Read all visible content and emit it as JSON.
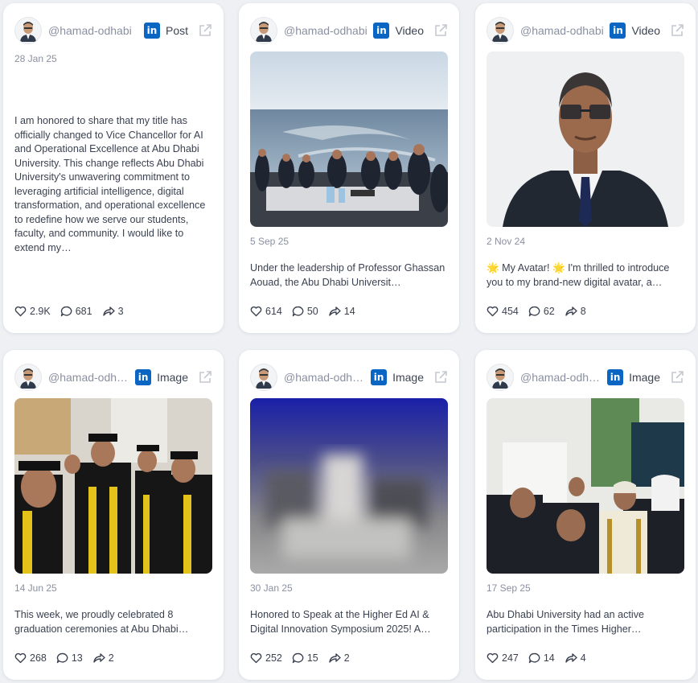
{
  "cards": [
    {
      "handle": "@hamad-odhabi",
      "type": "Post",
      "date": "28 Jan 25",
      "text": "I am honored to share that my title has officially changed to Vice Chancellor for AI and Operational Excellence at Abu Dhabi University. This change reflects Abu Dhabi University's unwavering commitment to leveraging artificial intelligence, digital transformation, and operational excellence to redefine how we serve our students, faculty, and community. I would like to extend my…",
      "likes": "2.9K",
      "comments": "681",
      "shares": "3"
    },
    {
      "handle": "@hamad-odhabi",
      "type": "Video",
      "date": "5 Sep 25",
      "text": "Under the leadership of Professor Ghassan Aouad, the Abu Dhabi Universit…",
      "likes": "614",
      "comments": "50",
      "shares": "14"
    },
    {
      "handle": "@hamad-odhabi",
      "type": "Video",
      "date": "2 Nov 24",
      "text": "🌟 My Avatar! 🌟 I'm thrilled to introduce you to my brand-new digital avatar, a…",
      "likes": "454",
      "comments": "62",
      "shares": "8"
    },
    {
      "handle": "@hamad-odhabi",
      "type": "Image",
      "date": "14 Jun 25",
      "text": "This week, we proudly celebrated 8 graduation ceremonies at Abu Dhabi…",
      "likes": "268",
      "comments": "13",
      "shares": "2"
    },
    {
      "handle": "@hamad-odhabi",
      "type": "Image",
      "date": "30 Jan 25",
      "text": "Honored to Speak at the Higher Ed AI & Digital Innovation Symposium 2025! A…",
      "likes": "252",
      "comments": "15",
      "shares": "2"
    },
    {
      "handle": "@hamad-odhabi",
      "type": "Image",
      "date": "17 Sep 25",
      "text": "Abu Dhabi University had an active participation in the Times Higher…",
      "likes": "247",
      "comments": "14",
      "shares": "4"
    }
  ],
  "colors": {
    "linkedin": "#0a66c2",
    "background": "#eef0f4",
    "card": "#ffffff"
  }
}
